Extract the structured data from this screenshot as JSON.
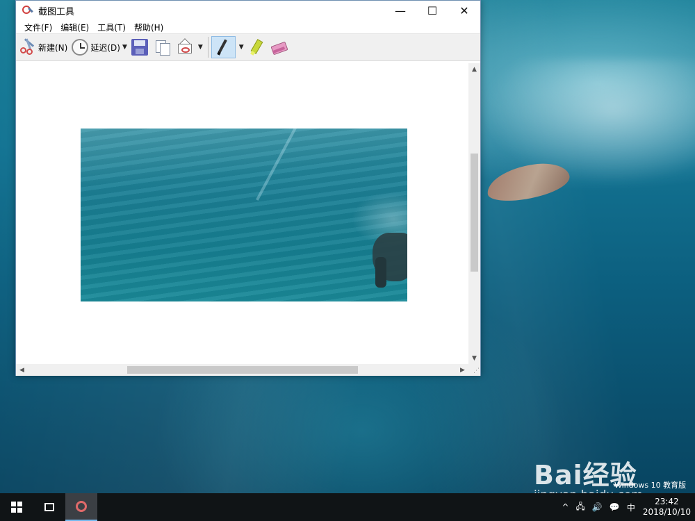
{
  "window": {
    "title": "截图工具",
    "minimize": "—",
    "maximize": "☐",
    "close": "✕"
  },
  "menu": [
    "文件(F)",
    "编辑(E)",
    "工具(T)",
    "帮助(H)"
  ],
  "toolbar": {
    "new_label": "新建(N)",
    "delay_label": "延迟(D)",
    "dropdown_glyph": "▼"
  },
  "scroll": {
    "up": "▲",
    "down": "▼",
    "left": "◀",
    "right": "▶",
    "grip": "⋰"
  },
  "watermark": {
    "logo": "Bai经验",
    "url": "jingyan.baidu.com"
  },
  "os_label": "Windows 10 教育版",
  "taskbar": {
    "tray_up": "^",
    "network": "🖧",
    "volume": "🔊",
    "notification": "💬",
    "ime": "中",
    "time": "23:42",
    "date": "2018/10/10"
  }
}
